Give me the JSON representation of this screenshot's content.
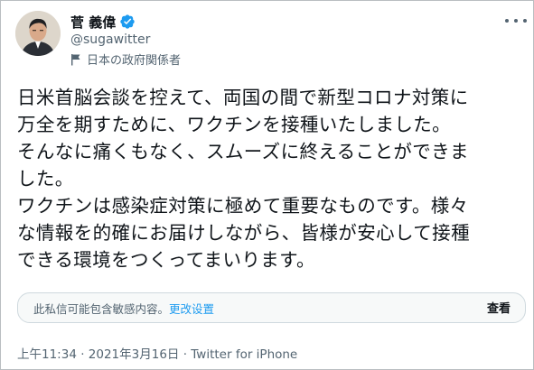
{
  "user": {
    "display_name": "菅 義偉",
    "handle": "@sugawitter",
    "label": "日本の政府関係者",
    "verified_icon": "verified-badge-icon",
    "brand_color": "#1d9bf0"
  },
  "tweet": {
    "text": "日米首脳会談を控えて、両国の間で新型コロナ対策に\n万全を期すために、ワクチンを接種いたしました。\nそんなに痛くもなく、スムーズに終えることができま\nした。\nワクチンは感染症対策に極めて重要なものです。様々\nな情報を的確にお届けしながら、皆様が安心して接種\nできる環境をつくってまいります。"
  },
  "sensitive_notice": {
    "text": "此私信可能包含敏感内容。",
    "settings_link": "更改设置",
    "view_button": "查看"
  },
  "meta": {
    "time": "上午11:34",
    "separator1": " · ",
    "date": "2021年3月16日",
    "separator2": " · ",
    "source": "Twitter for iPhone"
  }
}
